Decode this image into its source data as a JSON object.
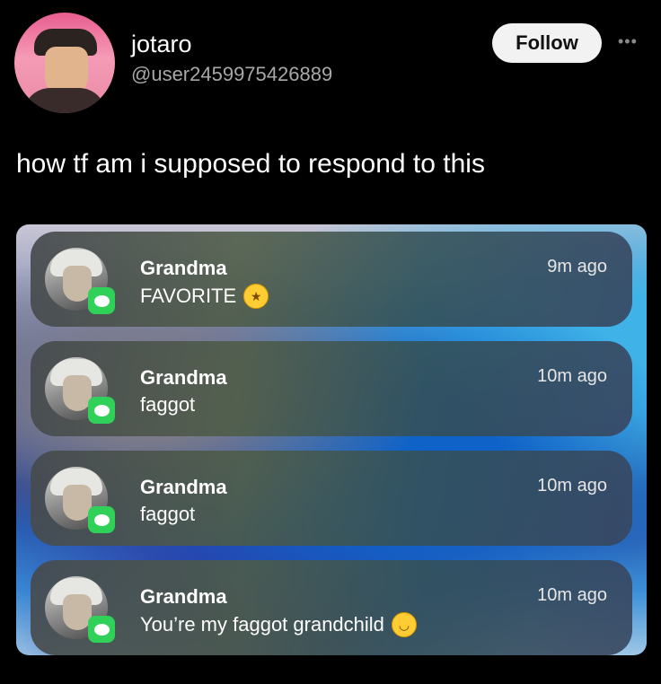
{
  "post": {
    "display_name": "jotaro",
    "username": "@user2459975426889",
    "follow_label": "Follow",
    "more_label": "•••",
    "text": "how tf am i supposed to respond to this"
  },
  "notifications": [
    {
      "sender": "Grandma",
      "message": "FAVORITE",
      "time": "9m ago",
      "emoji": "star-struck-emoji"
    },
    {
      "sender": "Grandma",
      "message": "faggot",
      "time": "10m ago"
    },
    {
      "sender": "Grandma",
      "message": "faggot",
      "time": "10m ago"
    },
    {
      "sender": "Grandma",
      "message": "You’re my faggot grandchild",
      "time": "10m ago",
      "emoji": "smiling-face-emoji"
    }
  ],
  "colors": {
    "background": "#000000",
    "follow_button_bg": "#f2f2f2",
    "messages_badge": "#2fd158"
  }
}
